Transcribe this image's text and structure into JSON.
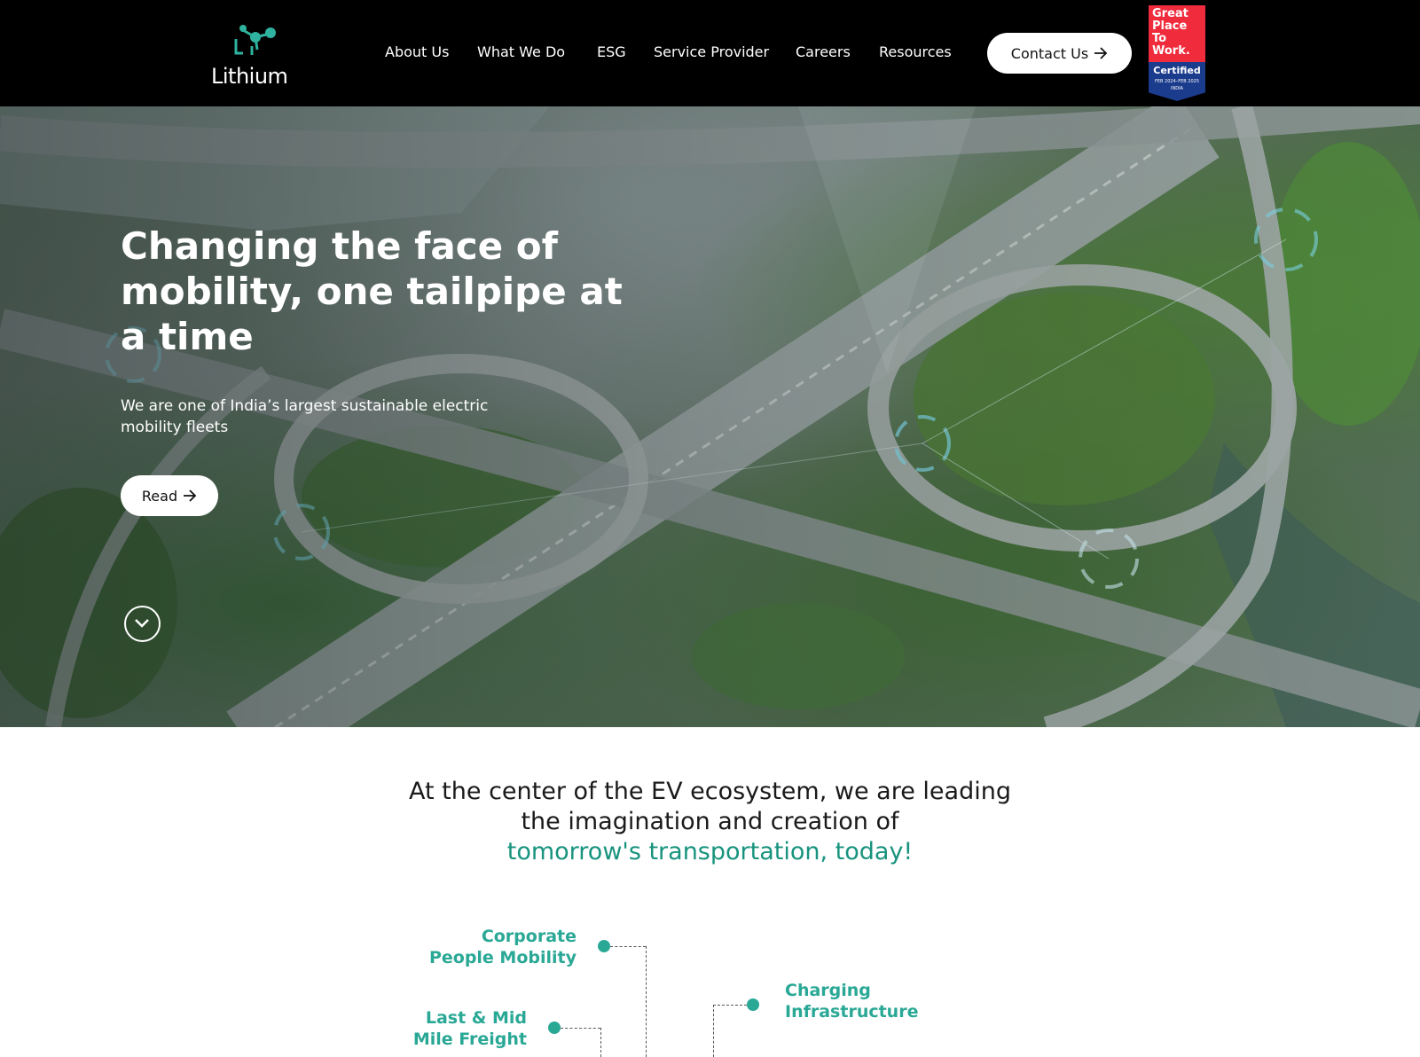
{
  "header": {
    "logo_text": "Lithium",
    "nav": [
      "About Us",
      "What We Do",
      "ESG",
      "Service Provider",
      "Careers",
      "Resources"
    ],
    "contact_label": "Contact Us",
    "badge": {
      "line1": "Great",
      "line2": "Place",
      "line3": "To",
      "line4": "Work.",
      "certified": "Certified",
      "dates": "FEB 2024–FEB 2025",
      "country": "INDIA",
      "color_top": "#ef2b3c",
      "color_bottom": "#1b3b8c"
    }
  },
  "hero": {
    "title": "Changing the face of mobility, one tailpipe at a time",
    "subtitle": "We are one of India’s largest sustainable electric mobility fleets",
    "read_label": "Read"
  },
  "mission": {
    "line1": "At the center of the EV ecosystem, we are leading",
    "line2": "the imagination and creation of",
    "line3": "tomorrow's transportation, today!",
    "accent_color": "#17937e"
  },
  "ecosystem": {
    "corporate_line1": "Corporate",
    "corporate_line2": "People Mobility",
    "freight_line1": "Last & Mid",
    "freight_line2": "Mile Freight",
    "charging_line1": "Charging",
    "charging_line2": "Infrastructure"
  }
}
